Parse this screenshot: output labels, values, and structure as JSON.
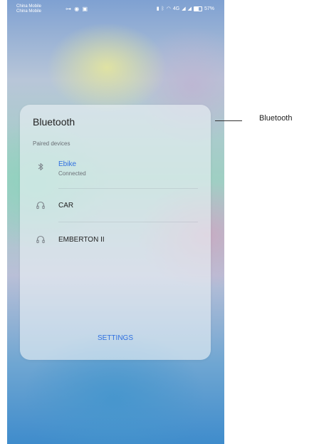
{
  "status_bar": {
    "carrier_line1": "China Mobile",
    "carrier_line2": "China Mobile",
    "battery_percent": "57%",
    "battery_level": 0.57,
    "signal_text": "4G"
  },
  "bluetooth_panel": {
    "title": "Bluetooth",
    "section_label": "Paired devices",
    "devices": [
      {
        "name": "Ebike",
        "status": "Connected",
        "icon": "bluetooth-icon",
        "active": true
      },
      {
        "name": "CAR",
        "status": "",
        "icon": "headphones-icon",
        "active": false
      },
      {
        "name": "EMBERTON II",
        "status": "",
        "icon": "headphones-icon",
        "active": false
      }
    ],
    "settings_label": "SETTINGS"
  },
  "callout": {
    "label": "Bluetooth"
  },
  "colors": {
    "accent": "#2f6fe0",
    "connected_text": "#2f6fe0"
  }
}
